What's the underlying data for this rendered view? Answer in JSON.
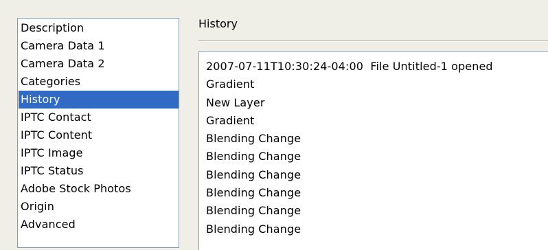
{
  "sidebar": {
    "items": [
      {
        "label": "Description",
        "selected": false
      },
      {
        "label": "Camera Data 1",
        "selected": false
      },
      {
        "label": "Camera Data 2",
        "selected": false
      },
      {
        "label": "Categories",
        "selected": false
      },
      {
        "label": "History",
        "selected": true
      },
      {
        "label": "IPTC Contact",
        "selected": false
      },
      {
        "label": "IPTC Content",
        "selected": false
      },
      {
        "label": "IPTC Image",
        "selected": false
      },
      {
        "label": "IPTC Status",
        "selected": false
      },
      {
        "label": "Adobe Stock Photos",
        "selected": false
      },
      {
        "label": "Origin",
        "selected": false
      },
      {
        "label": "Advanced",
        "selected": false
      }
    ]
  },
  "panel": {
    "title": "History",
    "history_lines": [
      "2007-07-11T10:30:24-04:00  File Untitled-1 opened",
      "Gradient",
      "New Layer",
      "Gradient",
      "Blending Change",
      "Blending Change",
      "Blending Change",
      "Blending Change",
      "Blending Change",
      "Blending Change"
    ]
  },
  "colors": {
    "selection_background": "#316ac5",
    "selection_text": "#ffffff",
    "window_background": "#f0efe7",
    "list_border": "#7f9db9"
  }
}
